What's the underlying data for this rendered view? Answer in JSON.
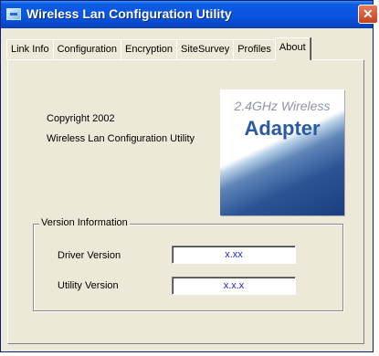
{
  "window": {
    "title": "Wireless Lan Configuration Utility",
    "close_glyph": "✕"
  },
  "tabs": [
    {
      "label": "Link Info"
    },
    {
      "label": "Configuration"
    },
    {
      "label": "Encryption"
    },
    {
      "label": "SiteSurvey"
    },
    {
      "label": "Profiles"
    },
    {
      "label": "About",
      "active": true
    }
  ],
  "about": {
    "copyright": "Copyright 2002",
    "product": "Wireless Lan Configuration Utility",
    "logo_line1": "2.4GHz Wireless",
    "logo_line2": "Adapter"
  },
  "version_info": {
    "legend": "Version Information",
    "driver_label": "Driver Version",
    "driver_value": "x.xx",
    "utility_label": "Utility Version",
    "utility_value": "x.x.x"
  },
  "colors": {
    "titlebar": "#0a55e3",
    "window_bg": "#ece9d8",
    "value_text": "#2020d8",
    "logo_blue": "#2a5aa0"
  },
  "icons": {
    "app": "app-icon",
    "close": "close-icon"
  }
}
